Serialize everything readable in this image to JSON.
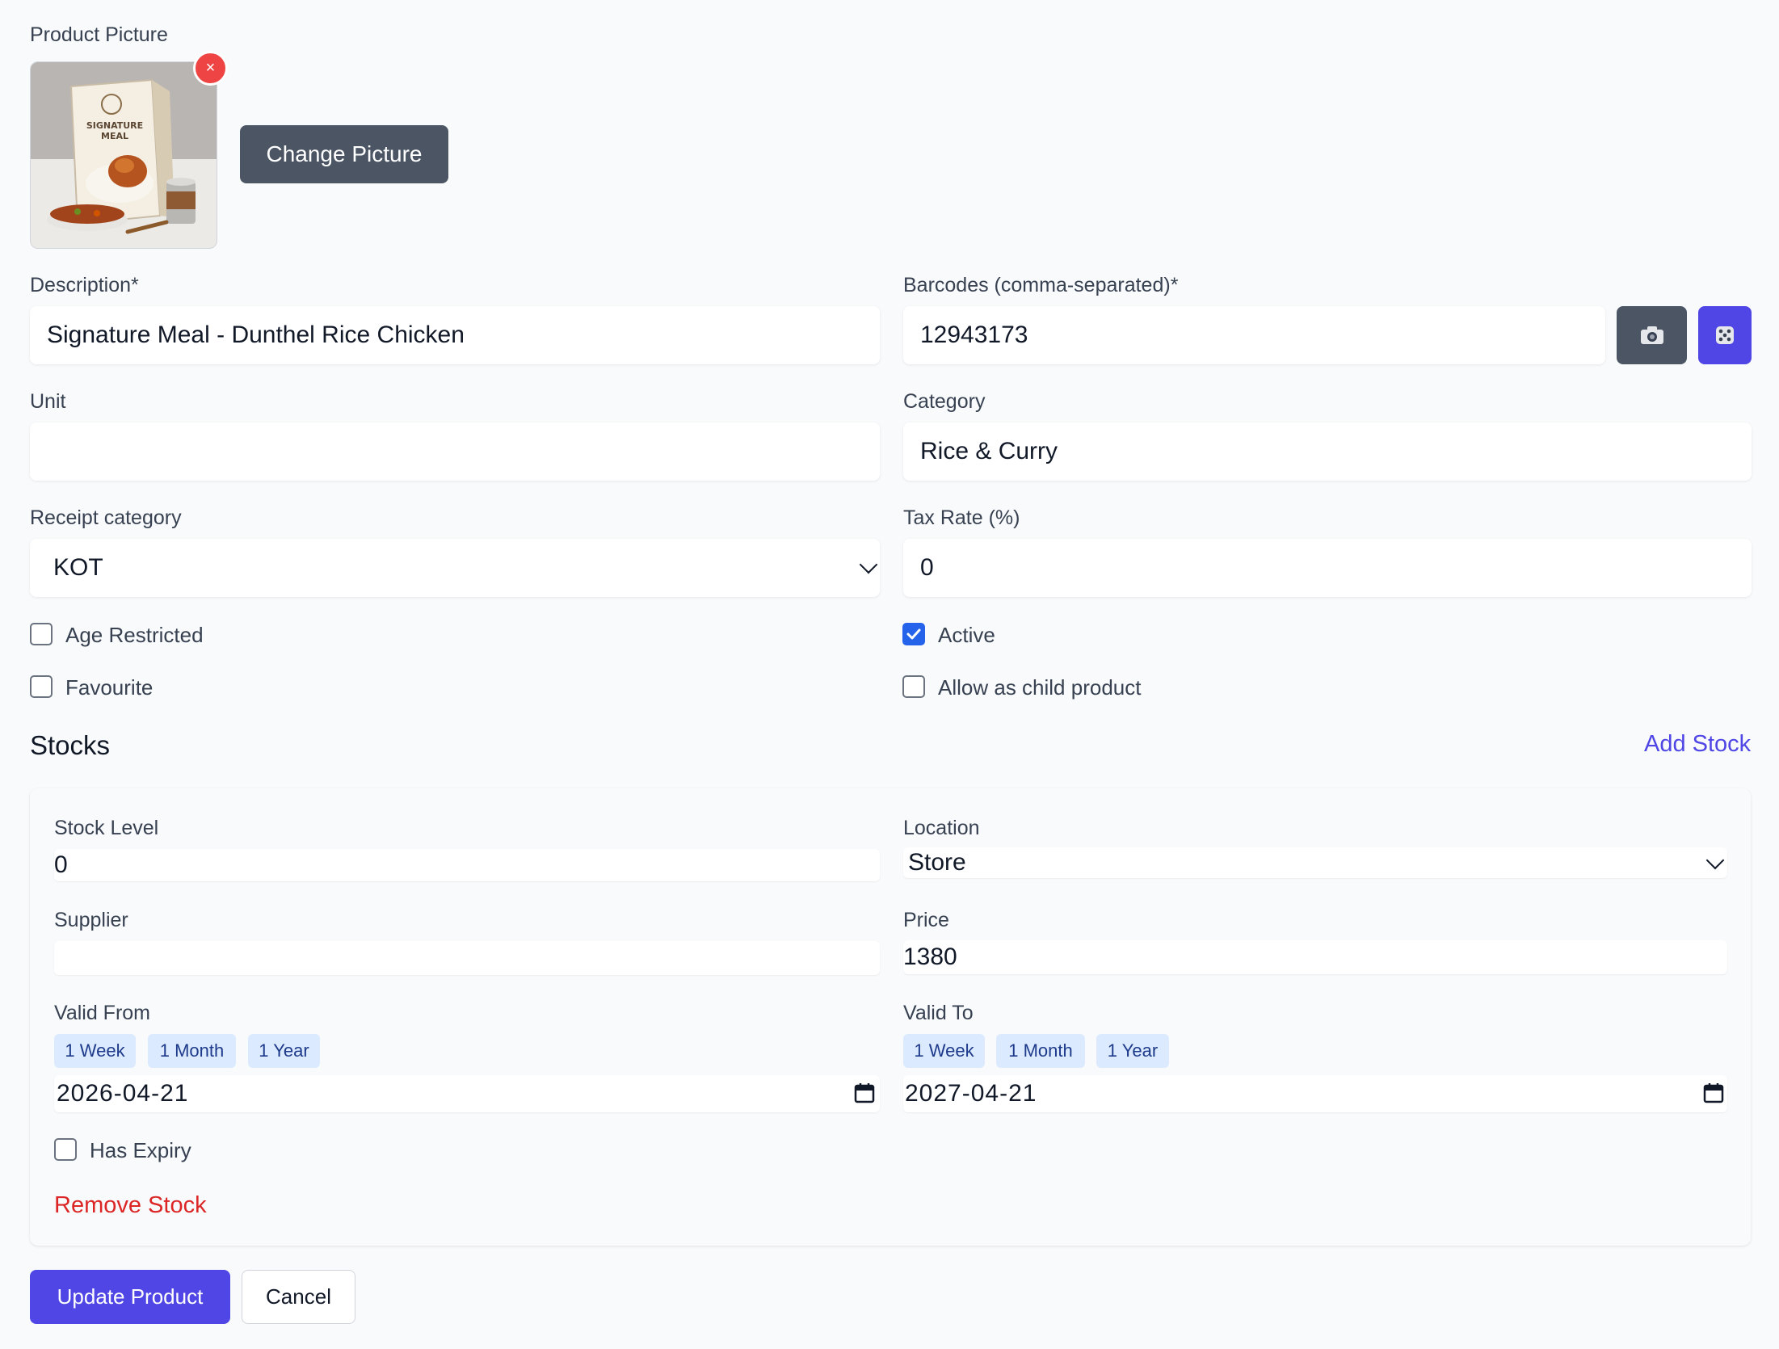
{
  "picture": {
    "label": "Product Picture",
    "change_button": "Change Picture",
    "remove_glyph": "×",
    "box_text_line1": "SIGNATURE",
    "box_text_line2": "MEAL"
  },
  "fields": {
    "description": {
      "label": "Description*",
      "value": "Signature Meal - Dunthel Rice Chicken"
    },
    "barcodes": {
      "label": "Barcodes (comma-separated)*",
      "value": "12943173",
      "camera_icon": "camera-icon",
      "dice_icon": "dice-icon"
    },
    "unit": {
      "label": "Unit",
      "value": ""
    },
    "category": {
      "label": "Category",
      "value": "Rice & Curry"
    },
    "receipt_category": {
      "label": "Receipt category",
      "value": "KOT"
    },
    "tax_rate": {
      "label": "Tax Rate (%)",
      "value": "0"
    }
  },
  "checkboxes": {
    "age_restricted": {
      "label": "Age Restricted",
      "checked": false
    },
    "favourite": {
      "label": "Favourite",
      "checked": false
    },
    "active": {
      "label": "Active",
      "checked": true
    },
    "allow_child": {
      "label": "Allow as child product",
      "checked": false
    }
  },
  "stocks": {
    "title": "Stocks",
    "add_label": "Add Stock",
    "items": [
      {
        "stock_level_label": "Stock Level",
        "stock_level": "0",
        "location_label": "Location",
        "location": "Store",
        "supplier_label": "Supplier",
        "supplier": "",
        "price_label": "Price",
        "price": "1380",
        "valid_from_label": "Valid From",
        "valid_from": "2026-04-21",
        "valid_to_label": "Valid To",
        "valid_to": "2027-04-21",
        "quick_ranges": [
          "1 Week",
          "1 Month",
          "1 Year"
        ],
        "has_expiry_label": "Has Expiry",
        "has_expiry": false,
        "remove_label": "Remove Stock"
      }
    ]
  },
  "actions": {
    "update_label": "Update Product",
    "cancel_label": "Cancel"
  },
  "colors": {
    "primary": "#4f46e5",
    "danger": "#dc2626",
    "link": "#4f46e5",
    "dark_button": "#4b5563"
  }
}
